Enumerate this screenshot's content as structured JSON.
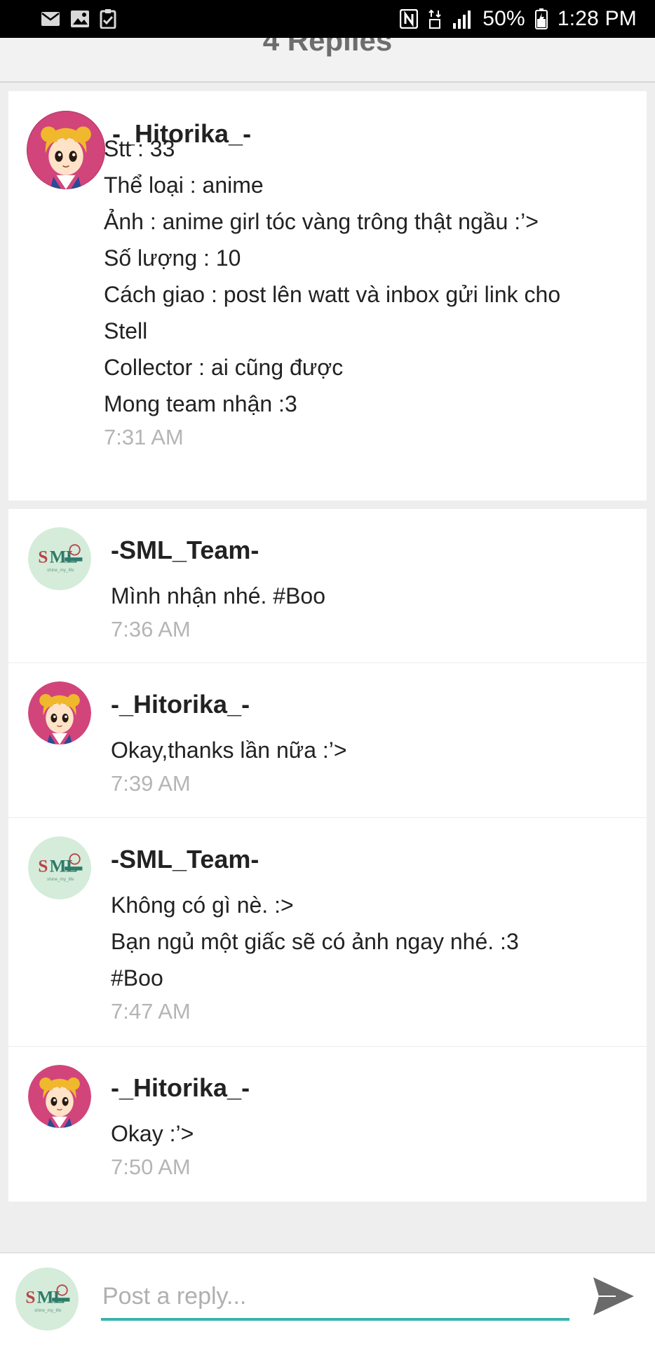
{
  "status_bar": {
    "battery": "50%",
    "time": "1:28 PM",
    "left_icons": [
      "mail-icon",
      "image-icon",
      "checklist-icon"
    ],
    "right_icons": [
      "nfc-icon",
      "data-4g-icon",
      "signal-icon",
      "battery-icon"
    ]
  },
  "header": {
    "title": "4 Replies"
  },
  "main_post": {
    "author": "-_Hitorika_-",
    "lines": [
      "Stt : 33",
      "Thể loại : anime",
      "Ảnh : anime girl tóc vàng trông thật ngầu :’>",
      "Số lượng : 10",
      "Cách giao : post lên watt và inbox gửi link cho",
      "Stell",
      "Collector : ai cũng được",
      "Mong team nhận :3"
    ],
    "time": "7:31 AM"
  },
  "replies": [
    {
      "author": "-SML_Team-",
      "avatar": "sml-team-avatar",
      "lines": [
        "Mình nhận nhé. #Boo"
      ],
      "time": "7:36 AM"
    },
    {
      "author": "-_Hitorika_-",
      "avatar": "anime-girl-avatar",
      "lines": [
        "Okay,thanks lần nữa :’>"
      ],
      "time": "7:39 AM"
    },
    {
      "author": "-SML_Team-",
      "avatar": "sml-team-avatar",
      "lines": [
        "Không có gì nè. :>",
        "Bạn ngủ một giấc sẽ có ảnh ngay nhé. :3",
        "#Boo"
      ],
      "time": "7:47 AM"
    },
    {
      "author": "-_Hitorika_-",
      "avatar": "anime-girl-avatar",
      "lines": [
        "Okay :’>"
      ],
      "time": "7:50 AM"
    }
  ],
  "composer": {
    "placeholder": "Post a reply...",
    "value": "",
    "send_icon": "send-icon"
  },
  "colors": {
    "accent": "#3ab3b0",
    "send_icon": "#6a6a6a",
    "timestamp": "#b5b5b5",
    "sml_avatar_bg": "#d4ecd9",
    "anime_avatar_bg": "#d2457a"
  }
}
